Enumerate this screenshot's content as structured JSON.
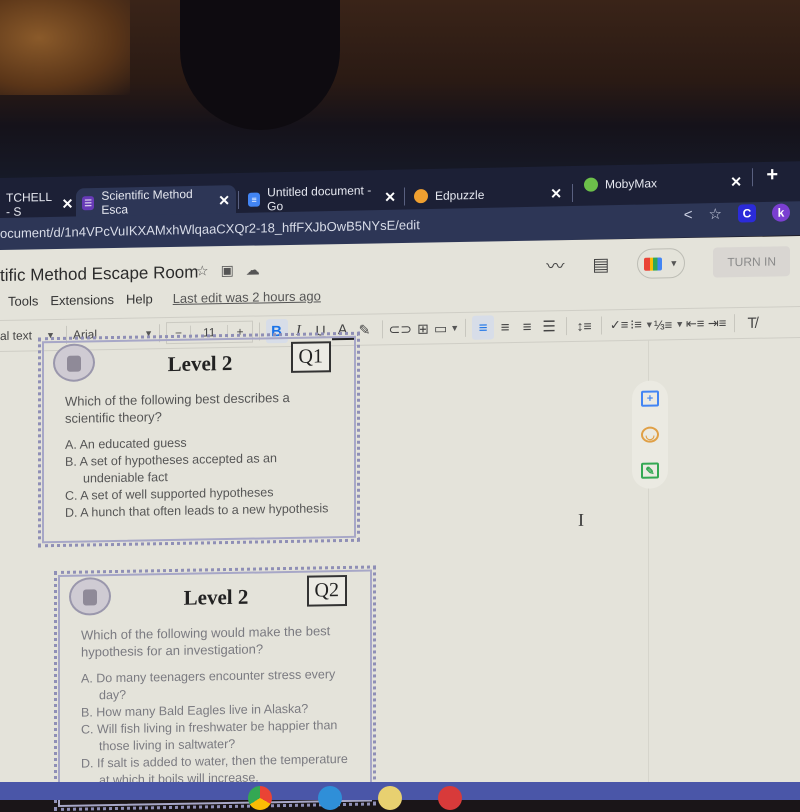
{
  "browser": {
    "tabs": [
      {
        "label": "TCHELL - S",
        "favicon": "generic",
        "active": false
      },
      {
        "label": "Scientific Method Esca",
        "favicon": "forms-icon",
        "active": true
      },
      {
        "label": "Untitled document - Go",
        "favicon": "docs-icon",
        "active": false
      },
      {
        "label": "Edpuzzle",
        "favicon": "edpuzzle-icon",
        "active": false
      },
      {
        "label": "MobyMax",
        "favicon": "mobymax-icon",
        "active": false
      }
    ],
    "new_tab": "+",
    "close_glyph": "✕",
    "url": "ocument/d/1n4VPcVuIKXAMxhWlqaaCXQr2-18_hffFXJbOwB5NYsE/edit",
    "extensions": [
      {
        "label": "C",
        "color": "#2b2bd9"
      },
      {
        "label": "k",
        "color": "#7a3fd1"
      }
    ]
  },
  "docs": {
    "title": "tific Method Escape Room",
    "menu": [
      "Tools",
      "Extensions",
      "Help"
    ],
    "last_edit": "Last edit was 2 hours ago",
    "turn_in": "TURN IN",
    "toolbar": {
      "style": "al text",
      "font": "Arial",
      "font_size": "11",
      "minus": "−",
      "plus": "+",
      "bold": "B",
      "italic": "I",
      "underline": "U",
      "text_color": "A"
    }
  },
  "document": {
    "cards": [
      {
        "level": "Level 2",
        "qnum": "Q1",
        "question": "Which of the following best describes a scientific theory?",
        "options": [
          "A. An educated guess",
          "B. A set of hypotheses accepted as an undeniable fact",
          "C. A set of well supported hypotheses",
          "D. A hunch that often leads to a new hypothesis"
        ]
      },
      {
        "level": "Level 2",
        "qnum": "Q2",
        "question": "Which of the following would make the best hypothesis for an investigation?",
        "options": [
          "A. Do many teenagers encounter stress every day?",
          "B. How many Bald Eagles live in Alaska?",
          "C. Will fish living in freshwater be happier than those living in saltwater?",
          "D. If salt is added to water, then the temperature at which it boils will increase."
        ]
      }
    ]
  },
  "colors": {
    "accent_blue": "#1a73e8",
    "add_comment": "#4285f4",
    "emoji": "#e0a046",
    "suggest": "#34a853"
  }
}
